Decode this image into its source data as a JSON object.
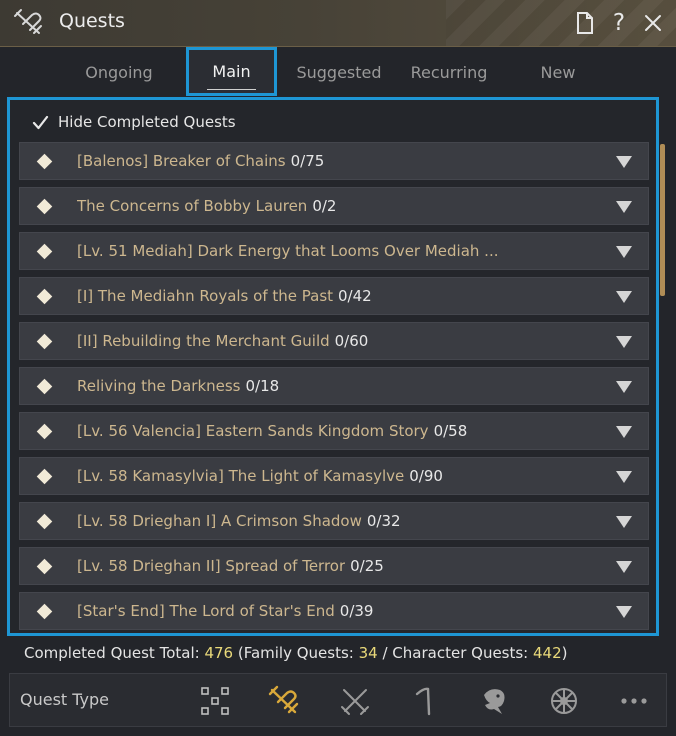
{
  "window": {
    "title": "Quests",
    "help_label": "?"
  },
  "tabs": [
    {
      "label": "Ongoing",
      "active": false
    },
    {
      "label": "Main",
      "active": true
    },
    {
      "label": "Suggested",
      "active": false
    },
    {
      "label": "Recurring",
      "active": false
    },
    {
      "label": "New",
      "active": false
    }
  ],
  "filter": {
    "hide_completed_label": "Hide Completed Quests",
    "hide_completed_checked": true
  },
  "quests": [
    {
      "name": "[Balenos] Breaker of Chains",
      "progress": "0/75"
    },
    {
      "name": "The Concerns of Bobby Lauren",
      "progress": "0/2"
    },
    {
      "name": "[Lv. 51 Mediah] Dark Energy that Looms Over Mediah ...",
      "progress": ""
    },
    {
      "name": "[I] The Mediahn Royals of the Past",
      "progress": "0/42"
    },
    {
      "name": "[II] Rebuilding the Merchant Guild",
      "progress": "0/60"
    },
    {
      "name": "Reliving the Darkness",
      "progress": "0/18"
    },
    {
      "name": "[Lv. 56 Valencia] Eastern Sands Kingdom Story",
      "progress": "0/58"
    },
    {
      "name": "[Lv. 58 Kamasylvia] The Light of Kamasylve",
      "progress": "0/90"
    },
    {
      "name": "[Lv. 58 Drieghan I] A Crimson Shadow",
      "progress": "0/32"
    },
    {
      "name": "[Lv. 58 Drieghan II] Spread of Terror",
      "progress": "0/25"
    },
    {
      "name": "[Star's End] The Lord of Star's End",
      "progress": "0/39"
    }
  ],
  "summary": {
    "completed_label": "Completed Quest Total: ",
    "completed_total": "476",
    "family_label": " (Family Quests: ",
    "family_count": "34",
    "character_label": " / Character Quests: ",
    "character_count": "442",
    "close_paren": ")"
  },
  "quest_type": {
    "label": "Quest Type",
    "icons": [
      "all-types-icon",
      "scroll-quill-icon",
      "crossed-swords-icon",
      "gathering-tool-icon",
      "fish-icon",
      "ship-wheel-icon",
      "more-icon"
    ]
  },
  "colors": {
    "accent_blue": "#1e96d4",
    "quest_name": "#cdb78f",
    "highlight_number": "#e9d97a",
    "scrollbar": "#b08d56",
    "active_type_icon": "#d9a93a"
  }
}
